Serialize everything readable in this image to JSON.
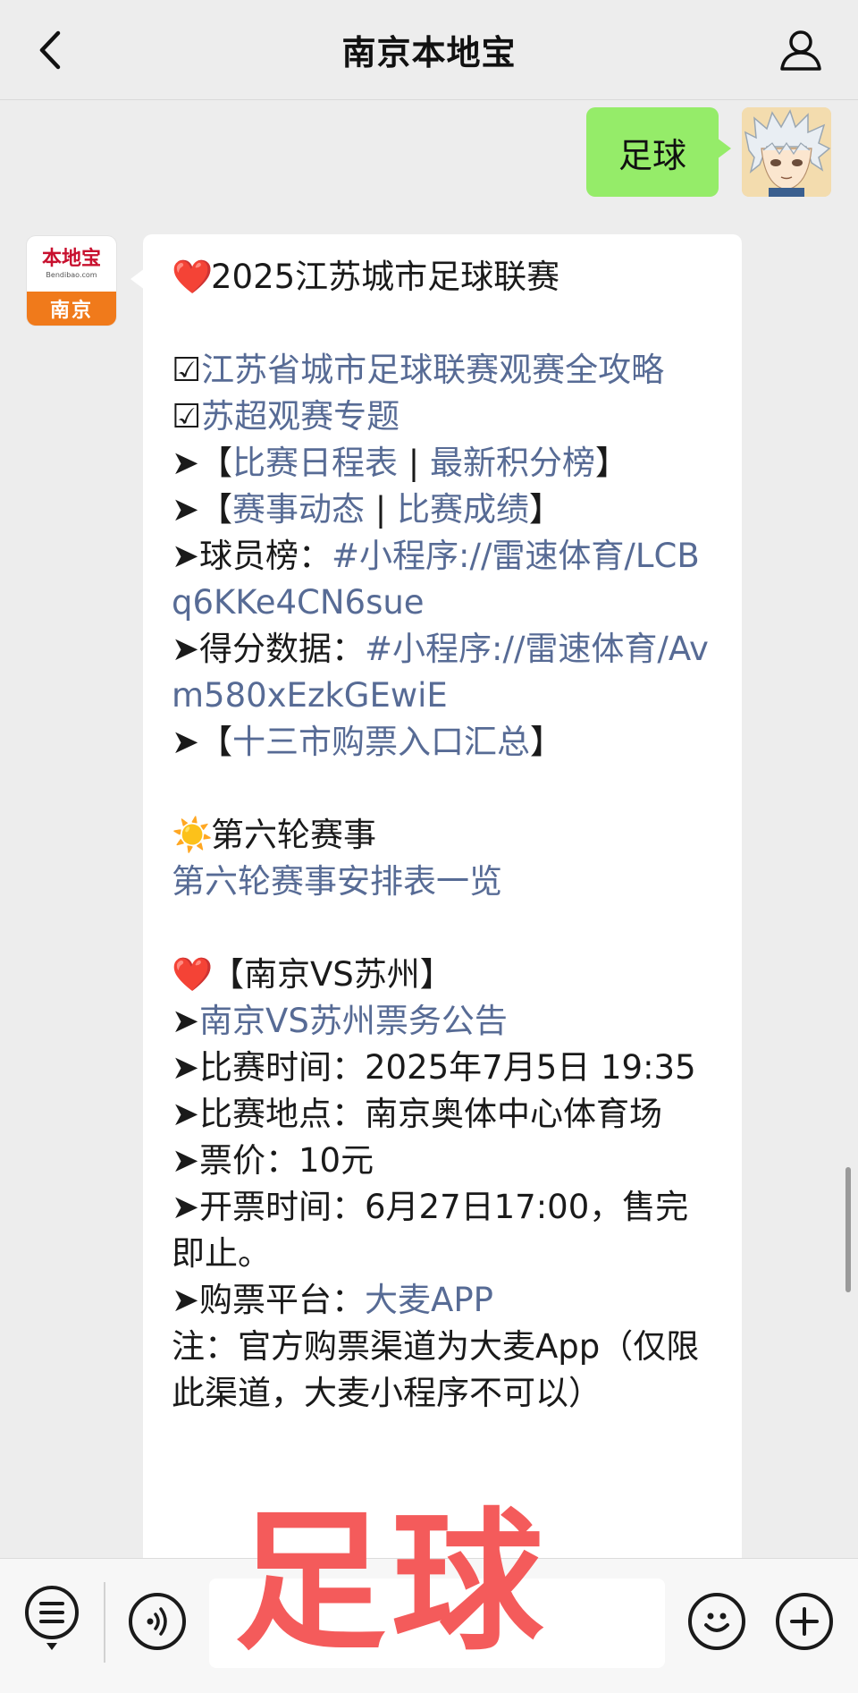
{
  "header": {
    "title": "南京本地宝"
  },
  "user_message": {
    "text": "足球"
  },
  "app_avatar": {
    "logo": "本地宝",
    "site": "Bendibao.com",
    "city": "南京"
  },
  "message_lines": [
    {
      "segments": [
        {
          "t": "❤️",
          "emo": true
        },
        {
          "t": "2025江苏城市足球联赛"
        }
      ]
    },
    {
      "blank": true
    },
    {
      "segments": [
        {
          "t": "☑"
        },
        {
          "t": "江苏省城市足球联赛观赛全攻略",
          "link": true
        }
      ]
    },
    {
      "segments": [
        {
          "t": "☑"
        },
        {
          "t": "苏超观赛专题",
          "link": true
        }
      ]
    },
    {
      "segments": [
        {
          "t": "➤【"
        },
        {
          "t": "比赛日程表",
          "link": true
        },
        {
          "t": " | "
        },
        {
          "t": "最新积分榜",
          "link": true
        },
        {
          "t": "】"
        }
      ]
    },
    {
      "segments": [
        {
          "t": "➤【"
        },
        {
          "t": "赛事动态",
          "link": true
        },
        {
          "t": " | "
        },
        {
          "t": "比赛成绩",
          "link": true
        },
        {
          "t": "】"
        }
      ]
    },
    {
      "segments": [
        {
          "t": "➤球员榜："
        },
        {
          "t": "#小程序://雷速体育/LCBq6KKe4CN6sue",
          "link": true
        }
      ]
    },
    {
      "segments": [
        {
          "t": "➤得分数据："
        },
        {
          "t": "#小程序://雷速体育/Avm580xEzkGEwiE",
          "link": true
        }
      ]
    },
    {
      "segments": [
        {
          "t": "➤【"
        },
        {
          "t": "十三市购票入口汇总",
          "link": true
        },
        {
          "t": "】"
        }
      ]
    },
    {
      "blank": true
    },
    {
      "segments": [
        {
          "t": "☀️",
          "emo": true
        },
        {
          "t": "第六轮赛事"
        }
      ]
    },
    {
      "segments": [
        {
          "t": "第六轮赛事安排表一览",
          "link": true
        }
      ]
    },
    {
      "blank": true
    },
    {
      "segments": [
        {
          "t": "❤️",
          "emo": true
        },
        {
          "t": "【南京VS苏州】"
        }
      ]
    },
    {
      "segments": [
        {
          "t": "➤"
        },
        {
          "t": "南京VS苏州票务公告",
          "link": true
        }
      ]
    },
    {
      "segments": [
        {
          "t": "➤比赛时间：2025年7月5日 19:35"
        }
      ]
    },
    {
      "segments": [
        {
          "t": "➤比赛地点：南京奥体中心体育场"
        }
      ]
    },
    {
      "segments": [
        {
          "t": "➤票价：10元"
        }
      ]
    },
    {
      "segments": [
        {
          "t": "➤开票时间：6月27日17:00，售完即止。"
        }
      ]
    },
    {
      "segments": [
        {
          "t": "➤购票平台："
        },
        {
          "t": "大麦APP",
          "link": true
        }
      ]
    },
    {
      "segments": [
        {
          "t": "注：官方购票渠道为大麦App（仅限此渠道，大麦小程序不可以）"
        }
      ]
    }
  ],
  "overlay": {
    "text": "足球"
  },
  "colors": {
    "link": "#576b95",
    "bubble_green": "#95ec69",
    "overlay": "#f45b5b"
  },
  "icons": [
    "back-arrow-icon",
    "user-icon",
    "menu-list-icon",
    "voice-icon",
    "emoji-icon",
    "plus-icon"
  ]
}
